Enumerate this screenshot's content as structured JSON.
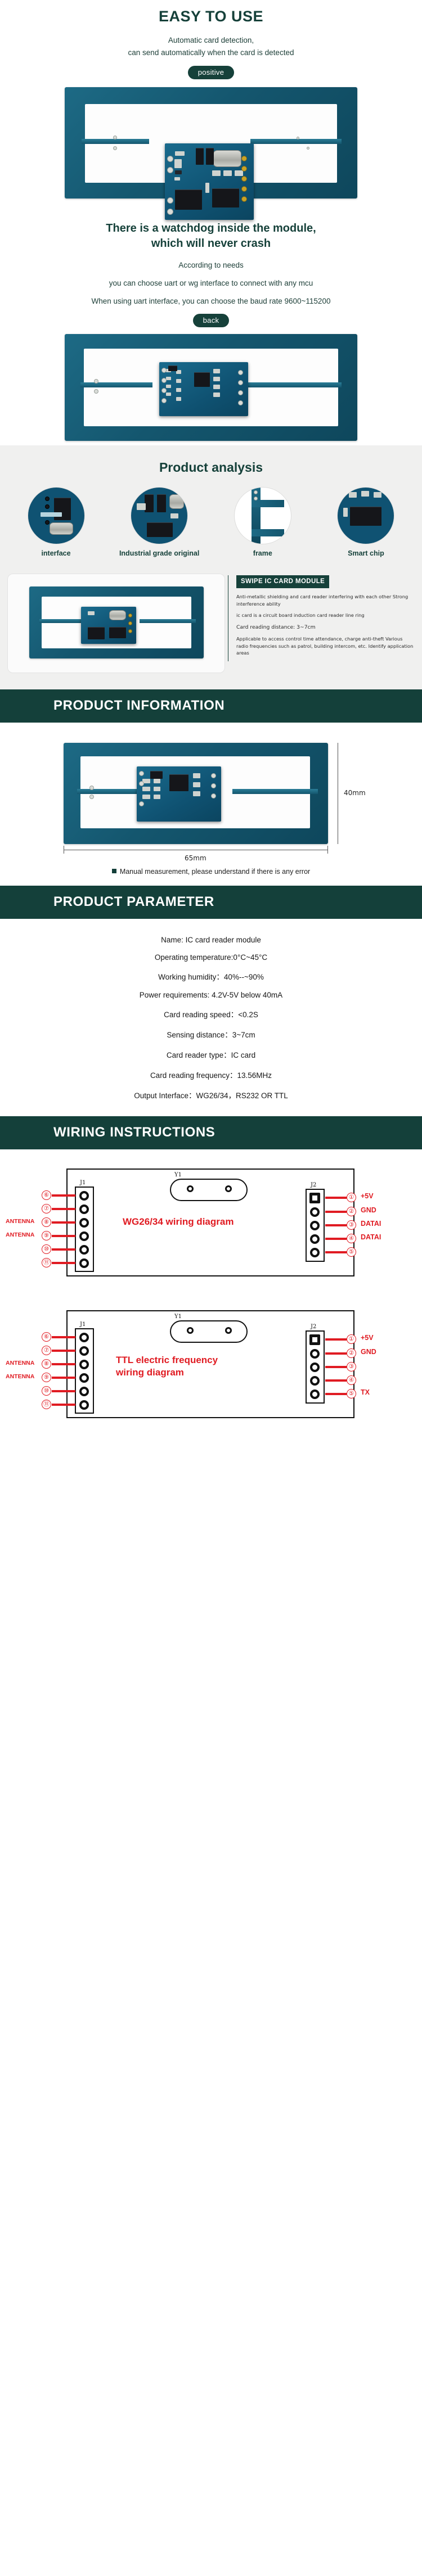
{
  "hero": {
    "title": "EASY TO USE",
    "sub_line1": "Automatic card detection,",
    "sub_line2": "can send automatically when the card is detected",
    "badge": "positive"
  },
  "watchdog": {
    "title_line1": "There is a watchdog inside the module,",
    "title_line2": "which will never crash",
    "sub_line1": "According to needs",
    "sub_line2": "you can choose uart or wg interface to connect with any mcu",
    "sub_line3": "When using uart interface, you can choose the baud rate 9600~115200",
    "badge": "back"
  },
  "analysis": {
    "heading": "Product analysis",
    "items": [
      {
        "caption": "interface"
      },
      {
        "caption": "Industrial grade original"
      },
      {
        "caption": "frame"
      },
      {
        "caption": "Smart chip"
      }
    ]
  },
  "swipe": {
    "badge": "SWIPE IC CARD MODULE",
    "para1": "Anti-metallic shielding and card reader interfering with each other Strong interference ability",
    "para2": "ic card is a circuit board induction card reader line ring",
    "para3": "Card reading distance: 3~7cm",
    "para4": "Applicable to access control time attendance, charge anti-theft Various radio frequencies such as patrol, building intercom, etc. Identify application areas"
  },
  "product_information": {
    "banner": "PRODUCT INFORMATION",
    "height_label": "40mm",
    "width_label": "65mm",
    "note": "Manual measurement, please understand if there is any error"
  },
  "product_parameter": {
    "banner": "PRODUCT PARAMETER",
    "rows": [
      "Name: IC card reader module",
      "Operating temperature:0°C~45°C",
      "Working humidity：40%--~90%",
      "Power requirements: 4.2V-5V below 40mA",
      "Card reading speed：<0.2S",
      "Sensing distance：3~7cm",
      "Card reader type：IC card",
      "Card reading frequency：13.56MHz",
      "Output Interface：WG26/34，RS232 OR TTL"
    ]
  },
  "wiring": {
    "banner": "WIRING INSTRUCTIONS",
    "diagrams": [
      {
        "title_line1": "WG26/34 wiring diagram",
        "title_line2": "",
        "left_connector": "J1",
        "right_connector": "J2",
        "silk_y1": "Y1",
        "left_pins": [
          {
            "num": "⑥",
            "label": ""
          },
          {
            "num": "⑦",
            "label": ""
          },
          {
            "num": "⑧",
            "label": "ANTENNA"
          },
          {
            "num": "⑨",
            "label": "ANTENNA"
          },
          {
            "num": "⑩",
            "label": ""
          },
          {
            "num": "⑪",
            "label": ""
          }
        ],
        "right_pins": [
          {
            "num": "①",
            "label": "+5V"
          },
          {
            "num": "②",
            "label": "GND"
          },
          {
            "num": "③",
            "label": "DATAI"
          },
          {
            "num": "④",
            "label": "DATAI"
          },
          {
            "num": "⑤",
            "label": ""
          }
        ]
      },
      {
        "title_line1": "TTL electric frequency",
        "title_line2": "wiring diagram",
        "left_connector": "J1",
        "right_connector": "J2",
        "silk_y1": "Y1",
        "left_pins": [
          {
            "num": "⑥",
            "label": ""
          },
          {
            "num": "⑦",
            "label": ""
          },
          {
            "num": "⑧",
            "label": "ANTENNA"
          },
          {
            "num": "⑨",
            "label": "ANTENNA"
          },
          {
            "num": "⑩",
            "label": ""
          },
          {
            "num": "⑪",
            "label": ""
          }
        ],
        "right_pins": [
          {
            "num": "①",
            "label": "+5V"
          },
          {
            "num": "②",
            "label": "GND"
          },
          {
            "num": "③",
            "label": ""
          },
          {
            "num": "④",
            "label": ""
          },
          {
            "num": "⑤",
            "label": "TX"
          }
        ]
      }
    ]
  },
  "colors": {
    "brand_dark_green": "#14403a",
    "accent_red": "#e01b22",
    "pcb_blue": "#0f5272",
    "panel_grey": "#f0f0ef"
  }
}
